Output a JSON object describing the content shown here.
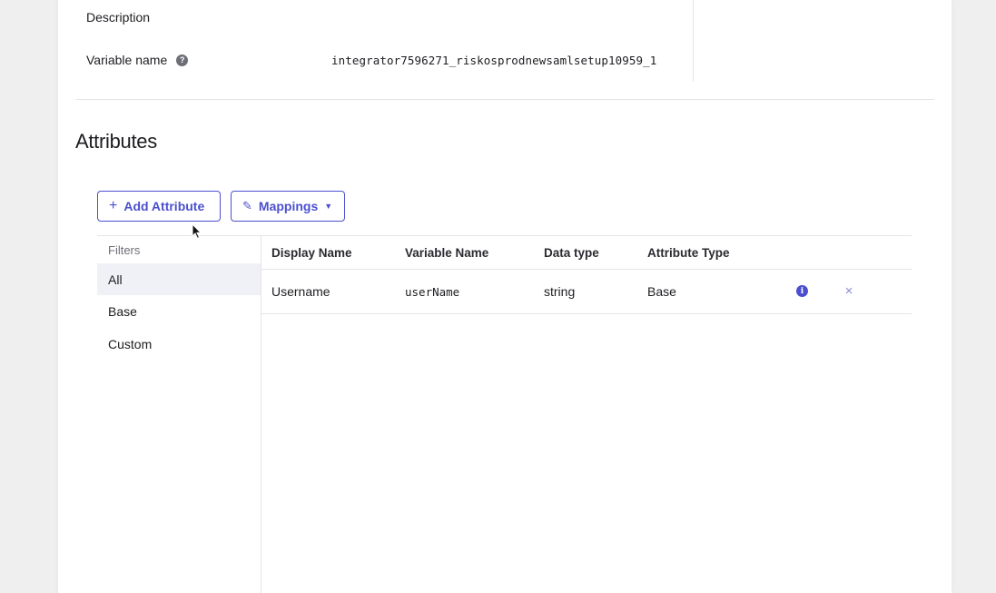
{
  "details": {
    "description_label": "Description",
    "variable_name_label": "Variable name",
    "variable_name_help_icon": "?",
    "variable_name_value": "integrator7596271_riskosprodnewsamlsetup10959_1"
  },
  "attributes": {
    "title": "Attributes",
    "add_button": {
      "icon": "+",
      "label": "Add Attribute"
    },
    "mappings_button": {
      "icon": "✎",
      "label": "Mappings",
      "caret": "▼"
    },
    "filters": {
      "heading": "Filters",
      "items": [
        "All",
        "Base",
        "Custom"
      ],
      "active": "All"
    },
    "table": {
      "columns": [
        "Display Name",
        "Variable Name",
        "Data type",
        "Attribute Type"
      ],
      "rows": [
        {
          "display_name": "Username",
          "variable_name": "userName",
          "data_type": "string",
          "attribute_type": "Base",
          "info_icon": "i",
          "remove_icon": "×"
        }
      ]
    }
  },
  "colors": {
    "accent": "#4b4fcf",
    "active_filter_bg": "#f0f0f7",
    "border": "#e4e4e8"
  }
}
